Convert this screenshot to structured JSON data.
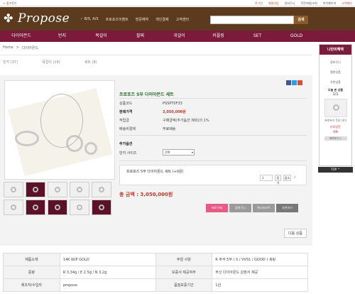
{
  "topbar": {
    "favorite": "즐겨찾기",
    "links": [
      "로그인",
      "회원가입",
      "장바구니",
      "주문/배송조회",
      "마이페이지",
      "고객센터"
    ]
  },
  "header": {
    "logo": "Propose",
    "nav": [
      "B/S, A/S",
      "프로포즈이벤트",
      "방문예약",
      "개인결제",
      "고객센터"
    ],
    "search_button": "검색"
  },
  "categories": [
    "다이아몬드",
    "반지",
    "목걸이",
    "팔찌",
    "귀걸이",
    "커플링",
    "SET",
    "GOLD"
  ],
  "breadcrumb": [
    "Home",
    ">",
    "다이아몬드"
  ],
  "sub_tabs": [
    "반지 (37)",
    "목걸이 (18)",
    "세트 (8)"
  ],
  "product": {
    "title": "프로포즈 5부 다이아몬드 세트",
    "info": [
      {
        "k": "상품코드",
        "v": "PSSPT0F33"
      },
      {
        "k": "판매가격",
        "v": "3,050,000원"
      },
      {
        "k": "적립금",
        "v": "구매금액(추가옵션 제외)의 1%"
      },
      {
        "k": "배송비결제",
        "v": "무료배송"
      }
    ],
    "option_header": "추가옵션",
    "option_label": "반지 사이즈",
    "option_select": "선택",
    "selected_option": "프로포즈 5부 다이아몬드 세트 (+0원)",
    "qty": "1",
    "btn_up": "증가",
    "btn_down": "감소",
    "btn_x": "X",
    "total": "총 금액 : 3,050,000원",
    "actions": [
      "바로구매",
      "장바구니",
      "위시리스트",
      "추천하기"
    ],
    "next_button": "다음 상품"
  },
  "spec": [
    [
      "제품소재",
      "14K W/P GOLD",
      "주얼 사양",
      "R 주석 5부 ( S / VVS1 / GOOD ) 세팅"
    ],
    [
      "중량",
      "R 3.34g / E 2.5g / N 3.2g",
      "보증서 제공여부",
      "부신 다이아몬드 감정서 제공"
    ],
    [
      "제조자/수입자",
      "propose",
      "품질보증기간",
      "1년"
    ]
  ],
  "sidebar": {
    "head": "나만의혜택",
    "links": [
      "장바구니",
      "찜한상품",
      "추천상품"
    ],
    "today": "오늘 본 상품",
    "pager": "1/1",
    "item_name": "프로포즈 5부 다이",
    "reservation": "바로방문",
    "on": "ON",
    "reserve_btn": "예약하기 >",
    "top": "TOP ^"
  },
  "colors": {
    "header_brown": "#5c3a1e",
    "category_wine": "#7b1a3a",
    "price_red": "#c0392b",
    "title_green": "#2a6d2a",
    "buy_pink": "#e65a86"
  }
}
